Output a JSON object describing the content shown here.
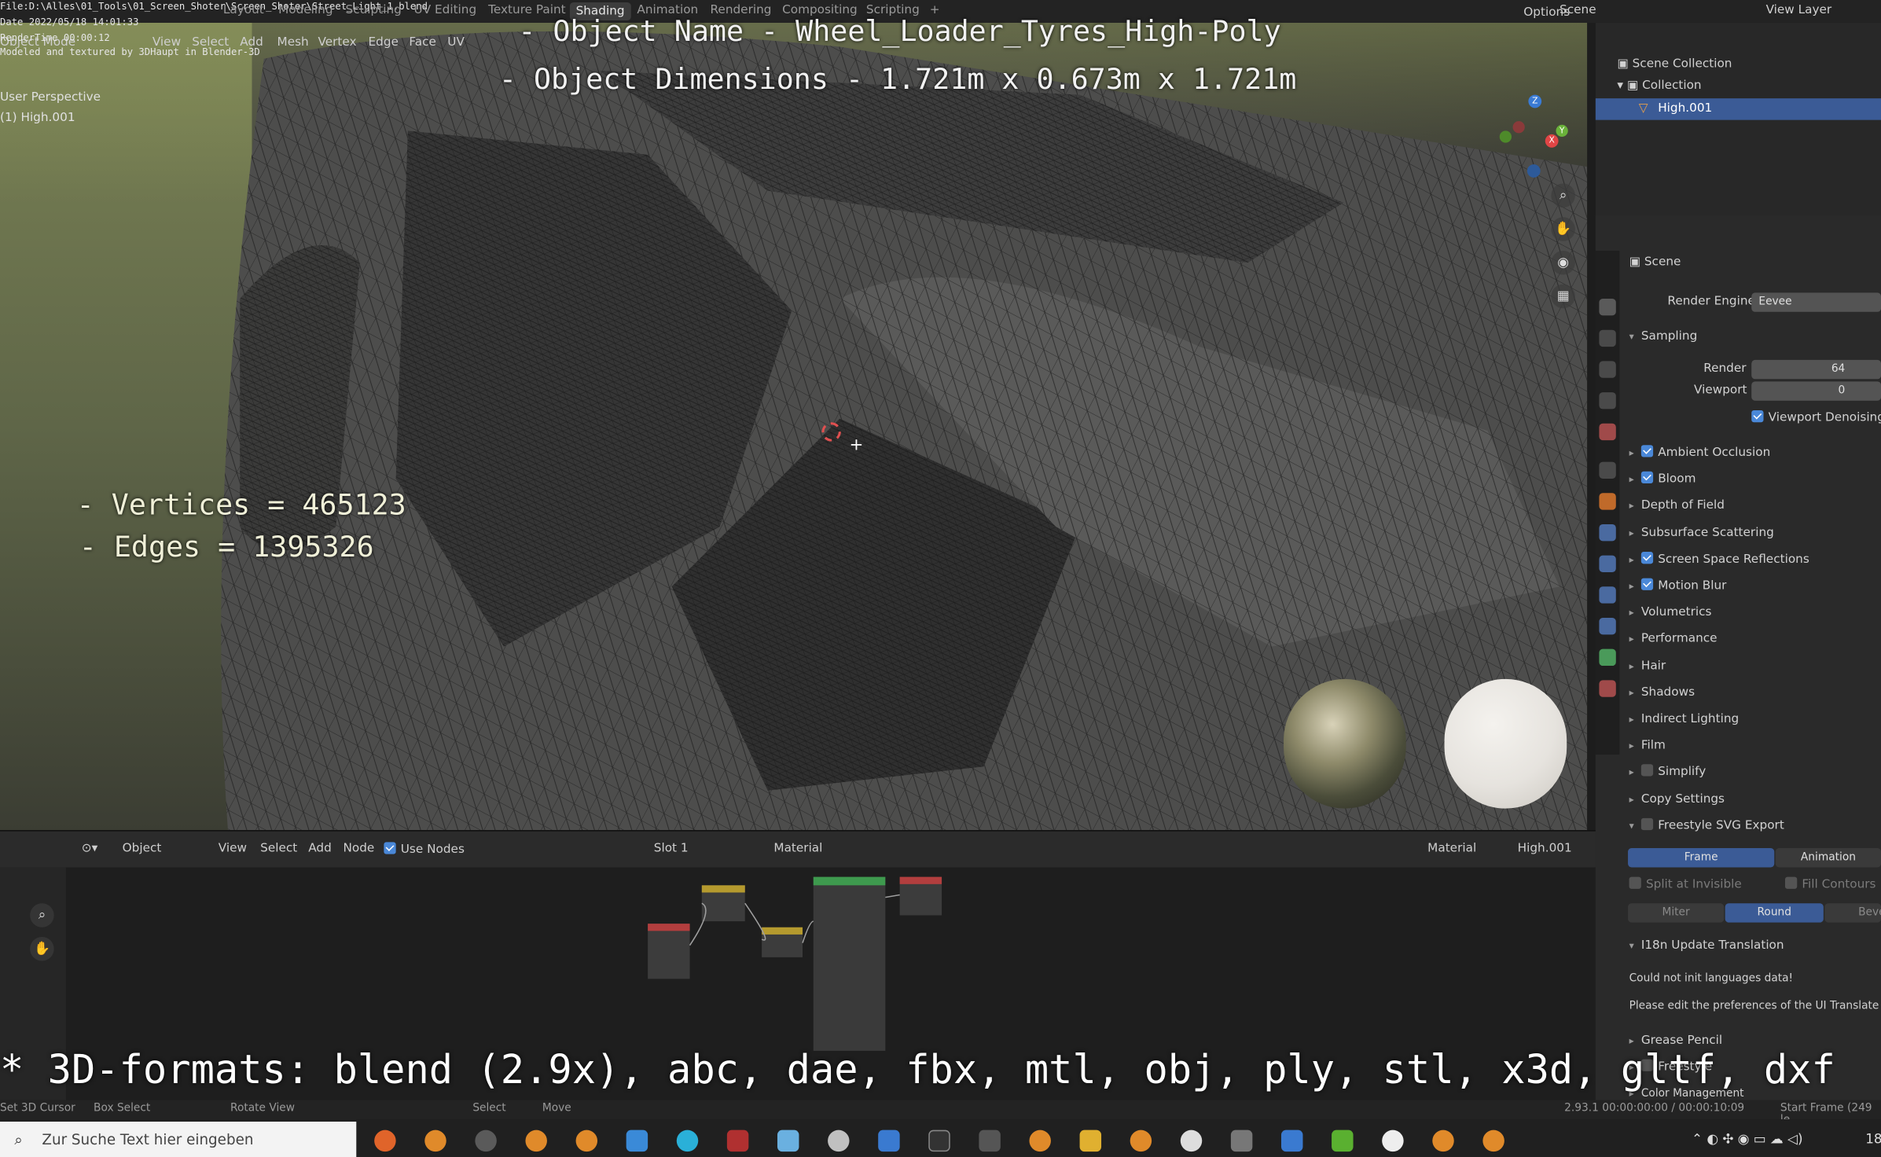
{
  "top_bar": {
    "file_path": "File:D:\\Alles\\01_Tools\\01_Screen_Shoter\\Screen_Shoter\\Street_Light_1.blend",
    "date": "Date 2022/05/18 14:01:33",
    "render_time": "RenderTime 00:00:12",
    "credit": "Modeled and textured by 3DHaupt in Blender-3D",
    "workspaces": [
      "Layout",
      "Modeling",
      "Sculpting",
      "UV Editing",
      "Texture Paint",
      "Shading",
      "Animation",
      "Rendering",
      "Compositing",
      "Scripting"
    ],
    "active_workspace": "Shading",
    "scene_label": "Scene",
    "view_layer_label": "View Layer"
  },
  "viewport": {
    "mode": "Object Mode",
    "menu": [
      "View",
      "Select",
      "Add",
      "Mesh",
      "Vertex",
      "Edge",
      "Face",
      "UV"
    ],
    "options_label": "Options",
    "view_name": "User Perspective",
    "object_label": "(1) High.001",
    "axis_labels": [
      "X",
      "Y",
      "Z"
    ]
  },
  "overlay": {
    "object_name_line": "- Object Name - Wheel_Loader_Tyres_High-Poly",
    "dimensions_line": "- Object Dimensions -  1.721m x 0.673m x 1.721m",
    "vertices_line": "- Vertices = 465123",
    "edges_line": "- Edges = 1395326",
    "formats_line": "* 3D-formats: blend (2.9x), abc, dae, fbx, mtl, obj, ply, stl, x3d, gltf, dxf"
  },
  "node_editor": {
    "type_label": "Object",
    "menu": [
      "View",
      "Select",
      "Add",
      "Node"
    ],
    "use_nodes_label": "Use Nodes",
    "slot_label": "Slot 1",
    "material_name": "Material",
    "right_material": "Material",
    "right_object": "High.001"
  },
  "outliner": {
    "root": "Scene Collection",
    "collection": "Collection",
    "object": "High.001"
  },
  "properties": {
    "context": "Scene",
    "render_engine_label": "Render Engine",
    "render_engine_value": "Eevee",
    "sampling_label": "Sampling",
    "render_label": "Render",
    "render_value": "64",
    "viewport_label": "Viewport",
    "viewport_value": "0",
    "viewport_denoising": "Viewport Denoising",
    "panels": [
      {
        "label": "Ambient Occlusion",
        "check": "on"
      },
      {
        "label": "Bloom",
        "check": "on"
      },
      {
        "label": "Depth of Field",
        "check": "none"
      },
      {
        "label": "Subsurface Scattering",
        "check": "none"
      },
      {
        "label": "Screen Space Reflections",
        "check": "on"
      },
      {
        "label": "Motion Blur",
        "check": "on"
      },
      {
        "label": "Volumetrics",
        "check": "none"
      },
      {
        "label": "Performance",
        "check": "none"
      },
      {
        "label": "Hair",
        "check": "none"
      },
      {
        "label": "Shadows",
        "check": "none"
      },
      {
        "label": "Indirect Lighting",
        "check": "none"
      },
      {
        "label": "Film",
        "check": "none"
      },
      {
        "label": "Simplify",
        "check": "off"
      },
      {
        "label": "Copy Settings",
        "check": "none"
      },
      {
        "label": "Freestyle SVG Export",
        "check": "off"
      }
    ],
    "frame_tab": "Frame",
    "animation_tab": "Animation",
    "split_invisible": "Split at Invisible",
    "fill_contours": "Fill Contours",
    "miter": "Miter",
    "round": "Round",
    "bevel": "Bevel",
    "i18n_label": "I18n Update Translation",
    "i18n_msg1": "Could not init languages data!",
    "i18n_msg2": "Please edit the preferences of the UI Translate add-on",
    "grease_pencil": "Grease Pencil",
    "freestyle": "Freestyle",
    "color_management": "Color Management"
  },
  "status_bar": {
    "left1": "Set 3D Cursor",
    "left2": "Box Select",
    "left3": "Rotate View",
    "mid1": "Select",
    "mid2": "Move",
    "version_info": "2.93.1  00:00:00:00 / 00:00:10:09",
    "start_frame": "Start Frame (249 le"
  },
  "taskbar": {
    "search_placeholder": "Zur Suche Text hier eingeben",
    "clock": "18"
  },
  "colors": {
    "accent": "#4a88d8",
    "active_tab": "#3b5b96",
    "panel_bg": "#2a2a2a"
  }
}
